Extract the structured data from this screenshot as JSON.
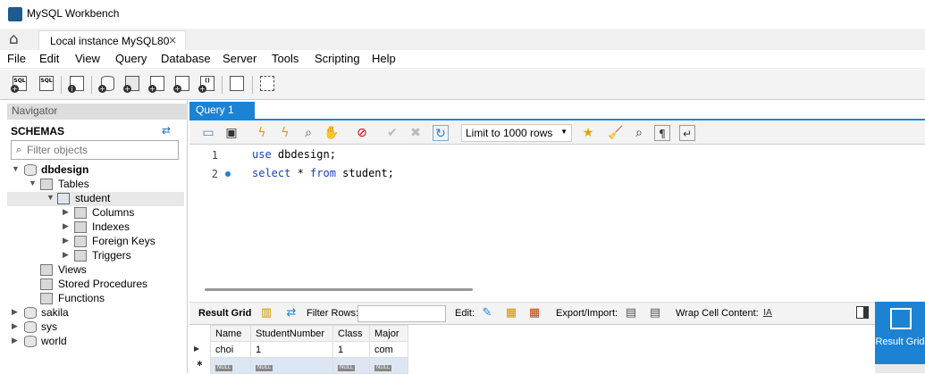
{
  "window": {
    "title": "MySQL Workbench"
  },
  "tabs": [
    {
      "label": "Local instance MySQL80",
      "close": "×"
    }
  ],
  "menu": [
    "File",
    "Edit",
    "View",
    "Query",
    "Database",
    "Server",
    "Tools",
    "Scripting",
    "Help"
  ],
  "toolbar_icons": [
    "new-sql-tab-icon",
    "open-sql-script-icon",
    "info-icon",
    "create-schema-icon",
    "create-table-icon",
    "create-view-icon",
    "create-procedure-icon",
    "create-function-icon",
    "search-table-icon",
    "reconnect-icon"
  ],
  "navigator": {
    "header": "Navigator",
    "schemas_label": "SCHEMAS",
    "filter_placeholder": "Filter objects",
    "tree": [
      {
        "label": "dbdesign",
        "bold": true
      },
      {
        "label": "Tables"
      },
      {
        "label": "student"
      },
      {
        "label": "Columns"
      },
      {
        "label": "Indexes"
      },
      {
        "label": "Foreign Keys"
      },
      {
        "label": "Triggers"
      },
      {
        "label": "Views"
      },
      {
        "label": "Stored Procedures"
      },
      {
        "label": "Functions"
      },
      {
        "label": "sakila"
      },
      {
        "label": "sys"
      },
      {
        "label": "world"
      }
    ]
  },
  "query": {
    "tab_label": "Query 1",
    "limit": "Limit to 1000 rows",
    "lines": [
      {
        "num": "1",
        "kw": "use",
        "rest": " dbdesign;"
      },
      {
        "num": "2",
        "kw": "select",
        "mid": " * ",
        "kw2": "from",
        "rest": " student;"
      }
    ]
  },
  "results": {
    "result_grid": "Result Grid",
    "filter_rows": "Filter Rows:",
    "edit": "Edit:",
    "export_import": "Export/Import:",
    "wrap": "Wrap Cell Content:",
    "side_button": "Result Grid",
    "columns": [
      "Name",
      "StudentNumber",
      "Class",
      "Major"
    ],
    "rows": [
      [
        "choi",
        "1",
        "1",
        "com"
      ]
    ],
    "null_label": "NULL"
  },
  "colors": {
    "accent": "#1c83d4"
  }
}
